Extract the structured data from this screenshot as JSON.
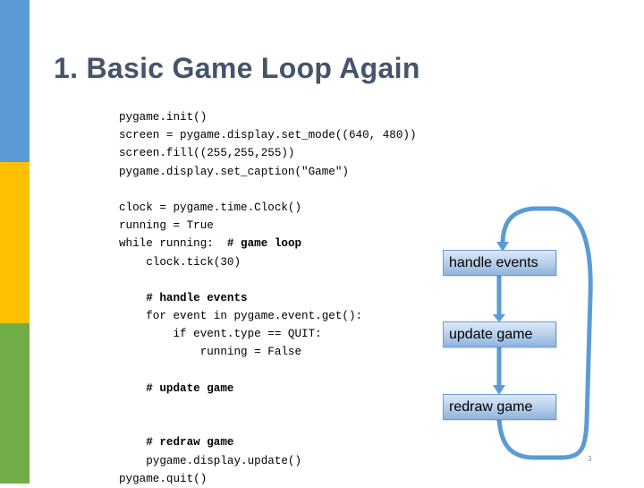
{
  "slide": {
    "title": "1.  Basic Game Loop Again",
    "page_number": "3",
    "colors": {
      "title": "#44546a",
      "sidebar": [
        "#5b9bd5",
        "#ffc000",
        "#70ad47"
      ],
      "arrow": "#5b9bd5",
      "box_border": "#6d9ad0"
    }
  },
  "code": {
    "lines": [
      {
        "text": "pygame.init()",
        "comment": ""
      },
      {
        "text": "screen = pygame.display.set_mode((640, 480))",
        "comment": ""
      },
      {
        "text": "screen.fill((255,255,255))",
        "comment": ""
      },
      {
        "text": "pygame.display.set_caption(\"Game\")",
        "comment": ""
      },
      {
        "text": "",
        "comment": ""
      },
      {
        "text": "clock = pygame.time.Clock()",
        "comment": ""
      },
      {
        "text": "running = True",
        "comment": ""
      },
      {
        "text": "while running:  ",
        "comment": "# game loop"
      },
      {
        "text": "    clock.tick(30)",
        "comment": ""
      },
      {
        "text": "",
        "comment": ""
      },
      {
        "text": "    ",
        "comment": "# handle events"
      },
      {
        "text": "    for event in pygame.event.get():",
        "comment": ""
      },
      {
        "text": "        if event.type == QUIT:",
        "comment": ""
      },
      {
        "text": "            running = False",
        "comment": ""
      },
      {
        "text": "",
        "comment": ""
      },
      {
        "text": "    ",
        "comment": "# update game"
      },
      {
        "text": "",
        "comment": ""
      },
      {
        "text": "",
        "comment": ""
      },
      {
        "text": "    ",
        "comment": "# redraw game"
      },
      {
        "text": "    pygame.display.update()",
        "comment": ""
      },
      {
        "text": "pygame.quit()",
        "comment": ""
      }
    ]
  },
  "diagram": {
    "steps": [
      {
        "id": "handle",
        "label": "handle events"
      },
      {
        "id": "update",
        "label": "update game"
      },
      {
        "id": "redraw",
        "label": "redraw game"
      }
    ],
    "arrows": [
      {
        "from": "handle",
        "to": "update",
        "icon": "arrow-down-icon"
      },
      {
        "from": "update",
        "to": "redraw",
        "icon": "arrow-down-icon"
      },
      {
        "from": "redraw",
        "to": "handle",
        "icon": "loop-back-arrow-icon"
      }
    ]
  }
}
